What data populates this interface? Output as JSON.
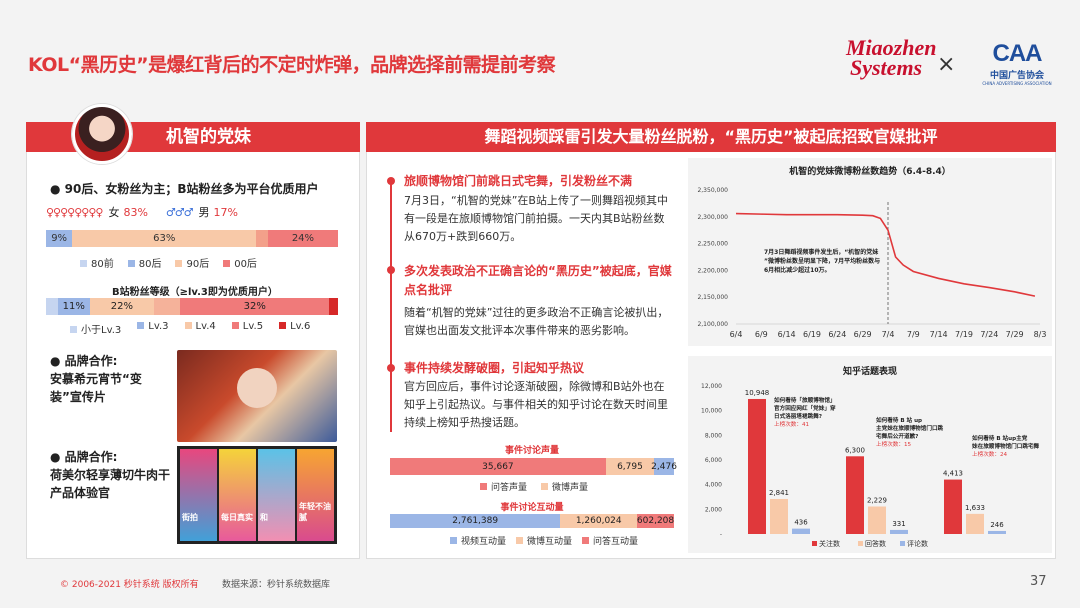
{
  "title": "KOL“黑历史”是爆红背后的不定时炸弹，品牌选择前需提前考察",
  "logos": {
    "miaozhen_line1": "Miaozhen",
    "miaozhen_line2": "Systems",
    "cross": "×",
    "caa_mark": "CAA",
    "caa_cn": "中国广告协会",
    "caa_en": "CHINA ADVERTISING ASSOCIATION"
  },
  "left": {
    "name": "机智的党妹",
    "fans_heading": "90后、女粉丝为主；B站粉丝多为平台优质用户",
    "female_label": "女",
    "female_pct": "83%",
    "male_label": "男",
    "male_pct": "17%",
    "age_bar": {
      "segments": [
        {
          "label": "9%",
          "value": 9
        },
        {
          "label": "63%",
          "value": 63
        },
        {
          "label": "",
          "value": 4
        },
        {
          "label": "24%",
          "value": 24
        }
      ],
      "legend": [
        "80前",
        "80后",
        "90后",
        "00后"
      ]
    },
    "level_heading": "B站粉丝等级（≥lv.3即为优质用户）",
    "level_bar": {
      "segments": [
        {
          "label": "",
          "value": 4
        },
        {
          "label": "11%",
          "value": 11
        },
        {
          "label": "22%",
          "value": 22
        },
        {
          "label": "",
          "value": 9
        },
        {
          "label": "32%",
          "value": 32
        },
        {
          "label": "",
          "value": 2
        }
      ],
      "legend": [
        "小于Lv.3",
        "Lv.3",
        "Lv.4",
        "Lv.5",
        "Lv.6"
      ]
    },
    "coop1_label": "品牌合作:",
    "coop1_text": "安慕希元宵节“变装”宣传片",
    "coop2_label": "品牌合作:",
    "coop2_text": "荷美尔轻享薄切牛肉干产品体验官",
    "promo_texts": [
      "街拍",
      "每日真实",
      "和",
      "年轻不油腻"
    ]
  },
  "right": {
    "header": "舞蹈视频踩雷引发大量粉丝脱粉，“黑历史”被起底招致官媒批评",
    "sec1_title": "旅顺博物馆门前跳日式宅舞，引发粉丝不满",
    "sec1_body": "7月3日，“机智的党妹”在B站上传了一则舞蹈视频其中有一段是在旅顺博物馆门前拍摄。一天内其B站粉丝数从670万+跌到660万。",
    "sec2_title": "多次发表政治不正确言论的“黑历史”被起底，官媒点名批评",
    "sec2_body": "随着“机智的党妹”过往的更多政治不正确言论被扒出，官媒也出面发文批评本次事件带来的恶劣影响。",
    "sec3_title": "事件持续发酵破圈，引起知乎热议",
    "sec3_body": "官方回应后，事件讨论逐渐破圈，除微博和B站外也在知乎上引起热议。与事件相关的知乎讨论在数天时间里持续上榜知乎热搜话题。",
    "voice_title": "事件讨论声量",
    "voice_legend": [
      "问答声量",
      "微博声量"
    ],
    "interact_title": "事件讨论互动量",
    "interact_legend": [
      "视频互动量",
      "微博互动量",
      "问答互动量"
    ]
  },
  "chart_data": [
    {
      "type": "bar",
      "title": "事件讨论声量",
      "orientation": "horizontal-stacked",
      "series": [
        {
          "name": "问答声量",
          "values": [
            35667
          ]
        },
        {
          "name": "微博声量",
          "values": [
            6795
          ]
        },
        {
          "name": "",
          "values": [
            2476
          ]
        }
      ],
      "labels": [
        "35,667",
        "6,795",
        "2,476"
      ],
      "colors": [
        "#f07a7a",
        "#f8c9a8",
        "#9bb6e6"
      ]
    },
    {
      "type": "bar",
      "title": "事件讨论互动量",
      "orientation": "horizontal-stacked",
      "series": [
        {
          "name": "视频互动量",
          "values": [
            2761389
          ]
        },
        {
          "name": "微博互动量",
          "values": [
            1260024
          ]
        },
        {
          "name": "问答互动量",
          "values": [
            602208
          ]
        }
      ],
      "labels": [
        "2,761,389",
        "1,260,024",
        "602,208"
      ],
      "colors": [
        "#9bb6e6",
        "#f8c9a8",
        "#f07a7a"
      ]
    },
    {
      "type": "line",
      "title": "机智的党妹微博粉丝数趋势（6.4-8.4）",
      "x": [
        "6/4",
        "6/9",
        "6/14",
        "6/19",
        "6/24",
        "6/29",
        "7/4",
        "7/9",
        "7/14",
        "7/19",
        "7/24",
        "7/29",
        "8/3"
      ],
      "y_ticks": [
        "2,100,000",
        "2,150,000",
        "2,200,000",
        "2,250,000",
        "2,300,000",
        "2,350,000"
      ],
      "ylim": [
        2100000,
        2350000
      ],
      "series": [
        {
          "points": [
            [
              0,
              2306000
            ],
            [
              1,
              2305000
            ],
            [
              2,
              2304000
            ],
            [
              3,
              2304000
            ],
            [
              4,
              2304000
            ],
            [
              5,
              2303000
            ],
            [
              5.4,
              2302000
            ],
            [
              5.7,
              2297000
            ],
            [
              6,
              2275000
            ],
            [
              6.3,
              2225000
            ],
            [
              6.6,
              2210000
            ],
            [
              7,
              2198000
            ],
            [
              8,
              2185000
            ],
            [
              9,
              2175000
            ],
            [
              10,
              2168000
            ],
            [
              11,
              2160000
            ],
            [
              11.8,
              2152000
            ]
          ]
        }
      ],
      "annotation": "7月3日舞蹈视频事件发生后，“机智的党妹”微博粉丝数呈明显下降，7月平均粉丝数与6月相比减少超过10万。",
      "colors": {
        "line": "#e0383b"
      }
    },
    {
      "type": "bar",
      "title": "知乎话题表现",
      "ylim": [
        0,
        12000
      ],
      "y_ticks": [
        "-",
        "2,000",
        "4,000",
        "6,000",
        "8,000",
        "10,000",
        "12,000"
      ],
      "groups": [
        {
          "values": [
            10948,
            2841,
            436
          ],
          "labels": [
            "10,948",
            "2,841",
            "436"
          ],
          "question": "如何看待「旅顺博物馆」官方回应网红「党妹」穿日式洛丽塔裙跳舞?",
          "rank": "上榜次数：41"
        },
        {
          "values": [
            6300,
            2229,
            331
          ],
          "labels": [
            "6,300",
            "2,229",
            "331"
          ],
          "question": "如何看待 B 站 up 主党妹在旅顺博物馆门口跳宅舞后公开道歉?",
          "rank": "上榜次数：15"
        },
        {
          "values": [
            4413,
            1633,
            246
          ],
          "labels": [
            "4,413",
            "1,633",
            "246"
          ],
          "question": "如何看待 B 站up主党妹在旅顺博物馆门口跳宅舞",
          "rank": "上榜次数：24"
        }
      ],
      "series": [
        {
          "name": "关注数"
        },
        {
          "name": "回答数"
        },
        {
          "name": "评论数"
        }
      ],
      "colors": [
        "#e0383b",
        "#f8c9a8",
        "#9bb6e6"
      ]
    }
  ],
  "footer": {
    "copyright": "© 2006-2021 秒针系统 版权所有",
    "source": "数据来源：秒针系统数据库",
    "page": "37"
  }
}
